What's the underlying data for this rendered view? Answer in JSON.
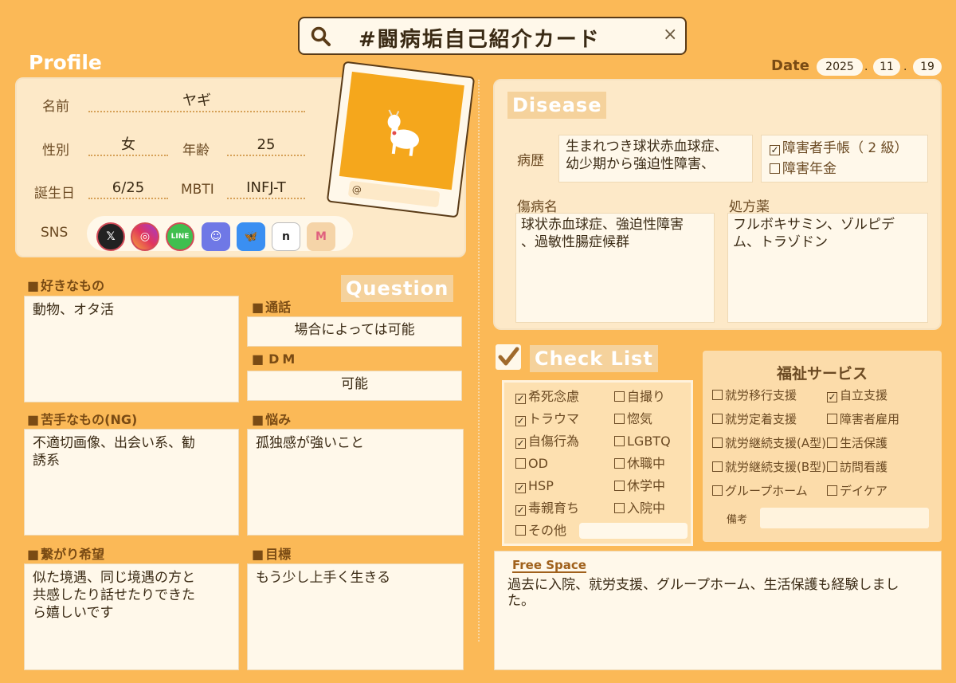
{
  "search": {
    "title": "#闘病垢自己紹介カード"
  },
  "profile": {
    "title": "Profile",
    "name_label": "名前",
    "name": "ヤギ",
    "gender_label": "性別",
    "gender": "女",
    "age_label": "年齢",
    "age": "25",
    "birthday_label": "誕生日",
    "birthday": "6/25",
    "mbti_label": "MBTI",
    "mbti": "INFJ-T",
    "sns_label": "SNS",
    "photo_handle": "@",
    "sns_icons": [
      "x-icon",
      "instagram-icon",
      "line-icon",
      "discord-icon",
      "bluesky-icon",
      "note-icon",
      "misskey-icon"
    ]
  },
  "date": {
    "label": "Date",
    "year": "2025",
    "month": "11",
    "day": "19",
    "sep": "."
  },
  "likes": {
    "title": "好きなもの",
    "text": "動物、オタ活"
  },
  "dislikes": {
    "title": "苦手なもの(NG)",
    "text": "不適切画像、出会い系、勧\n誘系"
  },
  "connect": {
    "title": "繋がり希望",
    "text": "似た境遇、同じ境遇の方と\n共感したり話せたりできた\nら嬉しいです"
  },
  "question": {
    "title": "Question",
    "call_title": "通話",
    "call": "場合によっては可能",
    "dm_title": "DM",
    "dm": "可能",
    "worry_title": "悩み",
    "worry": "孤独感が強いこと",
    "goal_title": "目標",
    "goal": "もう少し上手く生きる"
  },
  "disease": {
    "title": "Disease",
    "history_label": "病歴",
    "history": "生まれつき球状赤血球症、\n幼少期から強迫性障害、",
    "handbook": "障害者手帳（ 2 級）",
    "pension": "障害年金",
    "handbook_checked": true,
    "pension_checked": false,
    "diagnosis_label": "傷病名",
    "diagnosis": "球状赤血球症、強迫性障害\n、過敏性腸症候群",
    "meds_label": "処方薬",
    "meds": "フルボキサミン、ゾルピデ\nム、トラゾドン"
  },
  "checklist": {
    "title": "Check List",
    "left": [
      {
        "label": "希死念慮",
        "checked": true
      },
      {
        "label": "トラウマ",
        "checked": true
      },
      {
        "label": "自傷行為",
        "checked": true
      },
      {
        "label": "OD",
        "checked": false
      },
      {
        "label": "HSP",
        "checked": true
      },
      {
        "label": "毒親育ち",
        "checked": true
      }
    ],
    "right": [
      {
        "label": "自撮り",
        "checked": false
      },
      {
        "label": "惚気",
        "checked": false
      },
      {
        "label": "LGBTQ",
        "checked": false
      },
      {
        "label": "休職中",
        "checked": false
      },
      {
        "label": "休学中",
        "checked": false
      },
      {
        "label": "入院中",
        "checked": false
      }
    ],
    "other": "その他"
  },
  "welfare": {
    "title": "福祉サービス",
    "items": [
      {
        "label": "就労移行支援",
        "checked": false
      },
      {
        "label": "自立支援",
        "checked": true
      },
      {
        "label": "就労定着支援",
        "checked": false
      },
      {
        "label": "障害者雇用",
        "checked": false
      },
      {
        "label": "就労継続支援(A型)",
        "checked": false
      },
      {
        "label": "生活保護",
        "checked": false
      },
      {
        "label": "就労継続支援(B型)",
        "checked": false
      },
      {
        "label": "訪問看護",
        "checked": false
      },
      {
        "label": "グループホーム",
        "checked": false
      },
      {
        "label": "デイケア",
        "checked": false
      }
    ],
    "note_label": "備考"
  },
  "free": {
    "title": "Free Space",
    "text": "過去に入院、就労支援、グループホーム、生活保護も経験しまし\nた。"
  },
  "colors": {
    "bg": "#fbb957",
    "panel": "#fde9c8",
    "box": "#fff8ea",
    "accent": "#f5a71c"
  }
}
